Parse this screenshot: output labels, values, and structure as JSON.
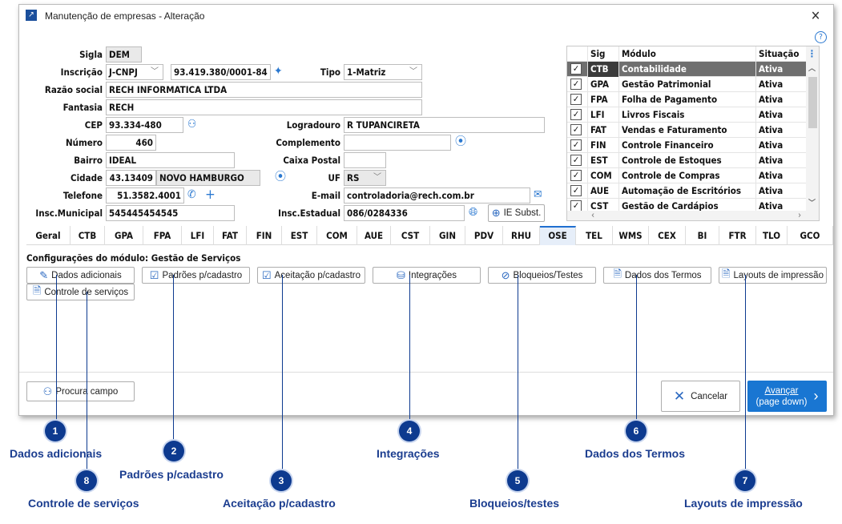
{
  "window": {
    "title": "Manutenção de empresas - Alteração"
  },
  "form": {
    "sigla": {
      "label": "Sigla",
      "value": "DEM"
    },
    "inscricao": {
      "label": "Inscrição",
      "type": "J-CNPJ",
      "value": "93.419.380/0001-84"
    },
    "tipo": {
      "label": "Tipo",
      "value": "1-Matriz"
    },
    "razao": {
      "label": "Razão social",
      "value": "RECH INFORMATICA LTDA"
    },
    "fantasia": {
      "label": "Fantasia",
      "value": "RECH"
    },
    "cep": {
      "label": "CEP",
      "value": "93.334-480"
    },
    "logradouro": {
      "label": "Logradouro",
      "value": "R TUPANCIRETA"
    },
    "numero": {
      "label": "Número",
      "value": "460"
    },
    "complemento": {
      "label": "Complemento",
      "value": ""
    },
    "bairro": {
      "label": "Bairro",
      "value": "IDEAL"
    },
    "caixa": {
      "label": "Caixa Postal",
      "value": ""
    },
    "cidade": {
      "label": "Cidade",
      "code": "43.13409",
      "name": "NOVO HAMBURGO"
    },
    "uf": {
      "label": "UF",
      "value": "RS"
    },
    "telefone": {
      "label": "Telefone",
      "value": "51.3582.4001"
    },
    "email": {
      "label": "E-mail",
      "value": "controladoria@rech.com.br"
    },
    "im": {
      "label": "Insc.Municipal",
      "value": "545445454545"
    },
    "ie": {
      "label": "Insc.Estadual",
      "value": "086/0284336"
    },
    "ie_subst": "IE Subst."
  },
  "grid": {
    "headers": [
      "Sig",
      "Módulo",
      "Situação"
    ],
    "rows": [
      [
        "CTB",
        "Contabilidade",
        "Ativa"
      ],
      [
        "GPA",
        "Gestão Patrimonial",
        "Ativa"
      ],
      [
        "FPA",
        "Folha de Pagamento",
        "Ativa"
      ],
      [
        "LFI",
        "Livros Fiscais",
        "Ativa"
      ],
      [
        "FAT",
        "Vendas e Faturamento",
        "Ativa"
      ],
      [
        "FIN",
        "Controle Financeiro",
        "Ativa"
      ],
      [
        "EST",
        "Controle de Estoques",
        "Ativa"
      ],
      [
        "COM",
        "Controle de Compras",
        "Ativa"
      ],
      [
        "AUE",
        "Automação de Escritórios",
        "Ativa"
      ],
      [
        "CST",
        "Gestão de Cardápios",
        "Ativa"
      ]
    ]
  },
  "tabs": [
    "Geral",
    "CTB",
    "GPA",
    "FPA",
    "LFI",
    "FAT",
    "FIN",
    "EST",
    "COM",
    "AUE",
    "CST",
    "GIN",
    "PDV",
    "RHU",
    "OSE",
    "TEL",
    "WMS",
    "CEX",
    "BI",
    "FTR",
    "TLO",
    "GCO"
  ],
  "active_tab": "OSE",
  "section_title": "Configurações do módulo: Gestão de Serviços",
  "buttons": [
    "Dados adicionais",
    "Padrões p/cadastro",
    "Aceitação p/cadastro",
    "Integrações",
    "Bloqueios/Testes",
    "Dados dos Termos",
    "Layouts de impressão",
    "Controle de serviços"
  ],
  "footer": {
    "search": "Procura campo",
    "cancel": "Cancelar",
    "next": "Avançar",
    "next_sub": "(page down)"
  },
  "callouts": [
    {
      "n": "1",
      "label": "Dados adicionais"
    },
    {
      "n": "2",
      "label": "Padrões p/cadastro"
    },
    {
      "n": "3",
      "label": "Aceitação p/cadastro"
    },
    {
      "n": "4",
      "label": "Integrações"
    },
    {
      "n": "5",
      "label": "Bloqueios/testes"
    },
    {
      "n": "6",
      "label": "Dados dos Termos"
    },
    {
      "n": "7",
      "label": "Layouts de impressão"
    },
    {
      "n": "8",
      "label": "Controle de serviços"
    }
  ],
  "colors": {
    "accent": "#1f6fd0",
    "callout": "#0d3a8f",
    "selected_row": "#6f6f6f"
  }
}
